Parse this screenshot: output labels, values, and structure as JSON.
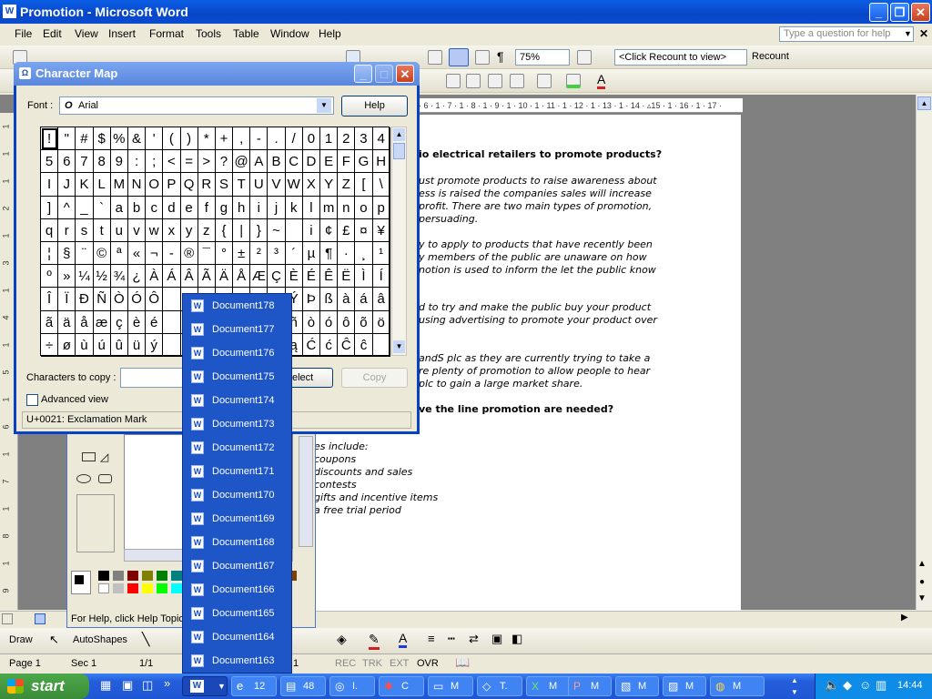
{
  "word": {
    "title": "Promotion - Microsoft Word",
    "menu": [
      "File",
      "Edit",
      "View",
      "Insert",
      "Format",
      "Tools",
      "Table",
      "Window",
      "Help"
    ],
    "ask_placeholder": "Type a question for help",
    "zoom": "75%",
    "recount_combo": "<Click Recount to view>",
    "recount_label": "Recount",
    "ruler_marks": "· 6 · 1 · 7 · 1 · 8 · 1 · 9 · 1 · 10 · 1 · 11 · 1 · 12 · 1 · 13 · 1 · 14 · ▵15 · 1 · 16 · 1 · 17 ·",
    "vruler_marks": [
      "1",
      "1",
      "1",
      "2",
      "1",
      "3",
      "1",
      "4",
      "1",
      "5",
      "1",
      "6",
      "1",
      "7",
      "1",
      "8",
      "1",
      "9"
    ],
    "doc_lines": [
      {
        "bold": true,
        "text": "io electrical retailers to promote products?"
      },
      {
        "text": "ust promote products to raise awareness about"
      },
      {
        "text": "ess is raised the companies sales will increase"
      },
      {
        "text": "profit. There are two main types of promotion,"
      },
      {
        "text": "persuading."
      },
      {
        "text": "y to apply to products that have recently been"
      },
      {
        "text": "y members of the public are unaware on how"
      },
      {
        "text": "notion is used to inform the let the public know"
      },
      {
        "text": "d to try and make the public buy your product"
      },
      {
        "text": "using advertising to promote your product over"
      },
      {
        "text": "andS plc as they are currently trying to take a"
      },
      {
        "text": "re plenty of promotion to allow people to hear"
      },
      {
        "text": "plc to gain a large market share."
      },
      {
        "bold": true,
        "text": "ve the line promotion are needed?"
      },
      {
        "text": "es include:"
      },
      {
        "text": "coupons"
      },
      {
        "text": "discounts and sales"
      },
      {
        "text": "contests"
      },
      {
        "text": "gifts and incentive items"
      },
      {
        "text": "a free trial period"
      }
    ],
    "draw_label": "Draw",
    "autoshapes_label": "AutoShapes",
    "status": {
      "page": "Page 1",
      "sec": "Sec 1",
      "pos": "1/1",
      "col": "1",
      "rec": "REC",
      "trk": "TRK",
      "ext": "EXT",
      "ovr": "OVR"
    }
  },
  "charmap": {
    "title": "Character Map",
    "font_label": "Font :",
    "font_value": "Arial",
    "help": "Help",
    "chars_label": "Characters to copy :",
    "select": "elect",
    "copy": "Copy",
    "advanced": "Advanced view",
    "status": "U+0021: Exclamation Mark",
    "rows": [
      [
        "!",
        "\"",
        "#",
        "$",
        "%",
        "&",
        "'",
        "(",
        ")",
        "*",
        "+",
        ",",
        "-",
        ".",
        "/",
        "0",
        "1",
        "2",
        "3",
        "4"
      ],
      [
        "5",
        "6",
        "7",
        "8",
        "9",
        ":",
        ";",
        "<",
        "=",
        ">",
        "?",
        "@",
        "A",
        "B",
        "C",
        "D",
        "E",
        "F",
        "G",
        "H"
      ],
      [
        "I",
        "J",
        "K",
        "L",
        "M",
        "N",
        "O",
        "P",
        "Q",
        "R",
        "S",
        "T",
        "U",
        "V",
        "W",
        "X",
        "Y",
        "Z",
        "[",
        "\\"
      ],
      [
        "]",
        "^",
        "_",
        "`",
        "a",
        "b",
        "c",
        "d",
        "e",
        "f",
        "g",
        "h",
        "i",
        "j",
        "k",
        "l",
        "m",
        "n",
        "o",
        "p"
      ],
      [
        "q",
        "r",
        "s",
        "t",
        "u",
        "v",
        "w",
        "x",
        "y",
        "z",
        "{",
        "|",
        "}",
        "~",
        "",
        "i",
        "¢",
        "£",
        "¤",
        "¥"
      ],
      [
        "¦",
        "§",
        "¨",
        "©",
        "ª",
        "«",
        "¬",
        "-",
        "®",
        "¯",
        "°",
        "±",
        "²",
        "³",
        "´",
        "µ",
        "¶",
        "·",
        "¸",
        "¹"
      ],
      [
        "º",
        "»",
        "¼",
        "½",
        "¾",
        "¿",
        "À",
        "Á",
        "Â",
        "Ã",
        "Ä",
        "Å",
        "Æ",
        "Ç",
        "È",
        "É",
        "Ê",
        "Ë",
        "Ì",
        "Í"
      ],
      [
        "Î",
        "Ï",
        "Ð",
        "Ñ",
        "Ò",
        "Ó",
        "Ô",
        "",
        "",
        "",
        "",
        "",
        "",
        "",
        "Ý",
        "Þ",
        "ß",
        "à",
        "á",
        "â"
      ],
      [
        "ã",
        "ä",
        "å",
        "æ",
        "ç",
        "è",
        "é",
        "",
        "",
        "",
        "",
        "",
        "",
        "",
        "ñ",
        "ò",
        "ó",
        "ô",
        "õ",
        "ö"
      ],
      [
        "÷",
        "ø",
        "ù",
        "ú",
        "û",
        "ü",
        "ý",
        "",
        "",
        "",
        "",
        "",
        "",
        "",
        "ą",
        "Ć",
        "ć",
        "Ĉ",
        "ĉ",
        ""
      ]
    ]
  },
  "paint": {
    "status": "For Help, click Help Topics"
  },
  "jumplist": [
    "Document178",
    "Document177",
    "Document176",
    "Document175",
    "Document174",
    "Document173",
    "Document172",
    "Document171",
    "Document170",
    "Document169",
    "Document168",
    "Document167",
    "Document166",
    "Document165",
    "Document164",
    "Document163"
  ],
  "taskbar": {
    "start": "start",
    "clock": "14:44",
    "tasks": [
      {
        "label": "12",
        "icon": "e"
      },
      {
        "label": "48",
        "icon": "f"
      },
      {
        "label": "I.",
        "icon": "i"
      },
      {
        "label": "C",
        "icon": "c"
      },
      {
        "label": "M",
        "icon": "m"
      },
      {
        "label": "T.",
        "icon": "t"
      },
      {
        "label": "M",
        "icon": "x"
      },
      {
        "label": "M",
        "icon": "p"
      },
      {
        "label": "M",
        "icon": "v"
      },
      {
        "label": "M",
        "icon": "s"
      },
      {
        "label": "M",
        "icon": "o"
      }
    ]
  }
}
